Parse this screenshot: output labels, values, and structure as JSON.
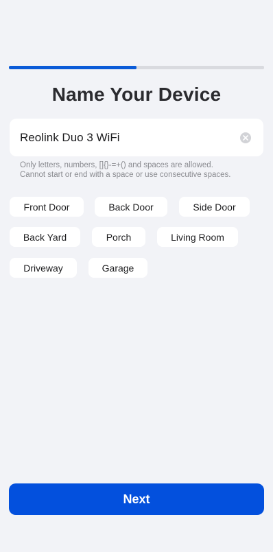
{
  "progress": {
    "fraction": 0.5
  },
  "page": {
    "title": "Name Your Device"
  },
  "name_field": {
    "value": "Reolink Duo 3 WiFi",
    "placeholder": ""
  },
  "helper": {
    "line1": "Only letters, numbers, []{}-=+() and spaces are allowed.",
    "line2": "Cannot start or end with a space or use consecutive spaces."
  },
  "suggestions": [
    "Front Door",
    "Back Door",
    "Side Door",
    "Back Yard",
    "Porch",
    "Living Room",
    "Driveway",
    "Garage"
  ],
  "footer": {
    "next_label": "Next"
  },
  "colors": {
    "accent": "#0350dd",
    "progress_fill": "#0a5bd8",
    "background": "#f2f3f7"
  },
  "icons": {
    "clear": "close-circle-icon"
  }
}
